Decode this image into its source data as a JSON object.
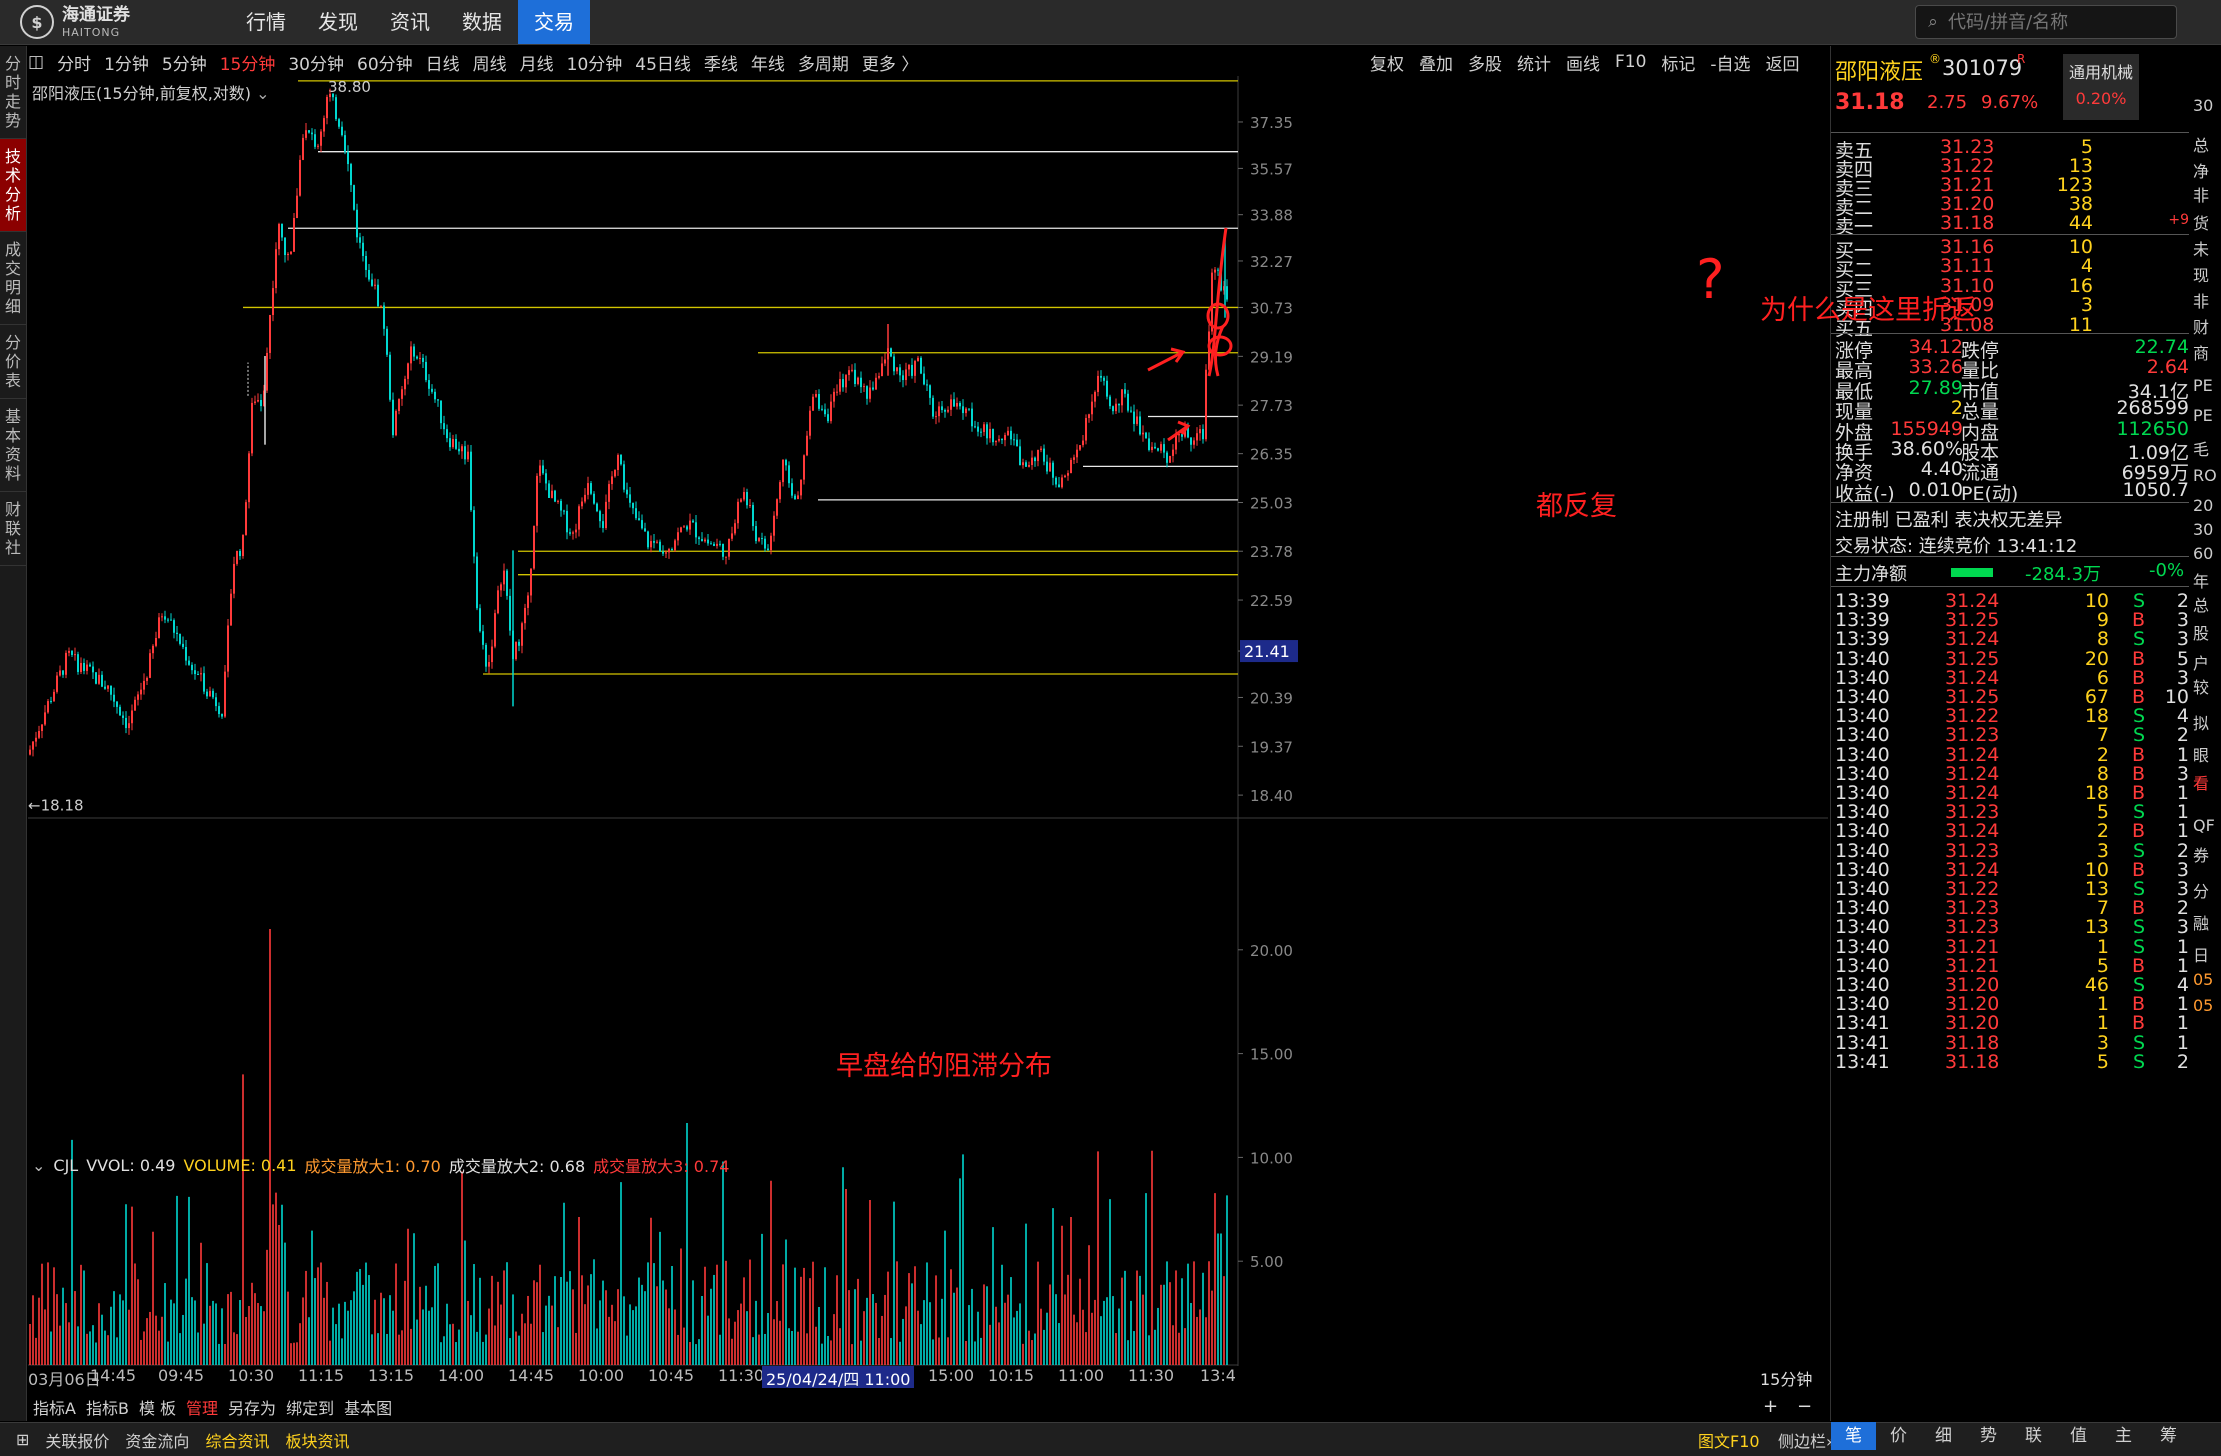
{
  "app": {
    "logo_cn": "海通证券",
    "logo_en": "HAITONG"
  },
  "mainnav": [
    "行情",
    "发现",
    "资讯",
    "数据",
    "交易"
  ],
  "search": {
    "placeholder": "代码/拼音/名称"
  },
  "sidetabs": [
    "分时走势",
    "技术分析",
    "成交明细",
    "分价表",
    "基本资料",
    "财联社"
  ],
  "periods": [
    "分时",
    "1分钟",
    "5分钟",
    "15分钟",
    "30分钟",
    "60分钟",
    "日线",
    "周线",
    "月线",
    "10分钟",
    "45日线",
    "季线",
    "年线",
    "多周期",
    "更多 〉"
  ],
  "tools": [
    "复权",
    "叠加",
    "多股",
    "统计",
    "画线",
    "F10",
    "标记",
    "-自选",
    "返回"
  ],
  "chart_title": "邵阳液压(15分钟,前复权,对数)",
  "chart_data": {
    "type": "candlestick",
    "yaxis_labels": [
      "37.35",
      "35.57",
      "33.88",
      "32.27",
      "30.73",
      "29.19",
      "27.73",
      "26.35",
      "25.03",
      "23.78",
      "22.59",
      "21.41",
      "20.39",
      "19.37",
      "18.40"
    ],
    "ylim": [
      18.0,
      39.2
    ],
    "current_price_tag": "21.41",
    "high_mark": "38.80",
    "low_mark": "←18.18",
    "levels_white": [
      36.2,
      33.4,
      27.4,
      26.0,
      25.1
    ],
    "levels_yellow": [
      39.0,
      30.73,
      29.3,
      23.78,
      23.2,
      20.9
    ],
    "volume_axis": [
      "20.00",
      "15.00",
      "10.00",
      "5.00"
    ],
    "volume_ylim": [
      0,
      25
    ]
  },
  "volume_header": {
    "name": "CJL",
    "vvol": "VVOL: 0.49",
    "volume": "VOLUME: 0.41",
    "amp1": "成交量放大1: 0.70",
    "amp2": "成交量放大2: 0.68",
    "amp3": "成交量放大3: 0.74"
  },
  "time_axis": [
    "03月06日",
    "14:45",
    "09:45",
    "10:30",
    "11:15",
    "13:15",
    "14:00",
    "14:45",
    "10:00",
    "10:45",
    "11:30",
    "13:30",
    "15:00",
    "10:15",
    "11:00",
    "11:30",
    "13:4"
  ],
  "time_highlight": "25/04/24/四 11:00",
  "period_label": "15分钟",
  "bottom_tabs": [
    "指标A",
    "指标B",
    "模 板",
    "管理",
    "另存为",
    "绑定到",
    "基本图"
  ],
  "bottom_tools": [
    "+",
    "−"
  ],
  "statusbar": [
    "关联报价",
    "资金流向",
    "综合资讯",
    "板块资讯"
  ],
  "statusbar_right": [
    "图文F10",
    "侧边栏»"
  ],
  "stock": {
    "name": "邵阳液压",
    "code": "301079",
    "r_mark": "R",
    "reg_mark": "®",
    "price": "31.18",
    "change": "2.75",
    "change_pct": "9.67%",
    "industry": "通用机械",
    "industry_pct": "0.20%"
  },
  "order_book": {
    "asks": [
      {
        "label": "卖五",
        "price": "31.23",
        "vol": "5",
        "extra": ""
      },
      {
        "label": "卖四",
        "price": "31.22",
        "vol": "13",
        "extra": ""
      },
      {
        "label": "卖三",
        "price": "31.21",
        "vol": "123",
        "extra": ""
      },
      {
        "label": "卖二",
        "price": "31.20",
        "vol": "38",
        "extra": ""
      },
      {
        "label": "卖一",
        "price": "31.18",
        "vol": "44",
        "extra": "+9"
      }
    ],
    "bids": [
      {
        "label": "买一",
        "price": "31.16",
        "vol": "10"
      },
      {
        "label": "买二",
        "price": "31.11",
        "vol": "4"
      },
      {
        "label": "买三",
        "price": "31.10",
        "vol": "16"
      },
      {
        "label": "买四",
        "price": "31.09",
        "vol": "3"
      },
      {
        "label": "买五",
        "price": "31.08",
        "vol": "11"
      }
    ]
  },
  "fundamentals": [
    {
      "l1": "涨停",
      "v1": "34.12",
      "l2": "跌停",
      "v2": "22.74"
    },
    {
      "l1": "最高",
      "v1": "33.26",
      "l2": "量比",
      "v2": "2.64"
    },
    {
      "l1": "最低",
      "v1": "27.89",
      "l2": "市值",
      "v2": "34.1亿"
    },
    {
      "l1": "现量",
      "v1": "2",
      "l2": "总量",
      "v2": "268599"
    },
    {
      "l1": "外盘",
      "v1": "155949",
      "l2": "内盘",
      "v2": "112650"
    },
    {
      "l1": "换手",
      "v1": "38.60%",
      "l2": "股本",
      "v2": "1.09亿"
    },
    {
      "l1": "净资",
      "v1": "4.40",
      "l2": "流通",
      "v2": "6959万"
    },
    {
      "l1": "收益(-)",
      "v1": "0.010",
      "l2": "PE(动)",
      "v2": "1050.7"
    }
  ],
  "reg_line": "注册制 已盈利 表决权无差异",
  "trade_status": "交易状态: 连续竞价 13:41:12",
  "main_flow": {
    "label": "主力净额",
    "value": "-284.3万",
    "pct": "-0%"
  },
  "ticks": [
    {
      "t": "13:39",
      "p": "31.24",
      "v": "10",
      "s": "S",
      "n": "2"
    },
    {
      "t": "13:39",
      "p": "31.25",
      "v": "9",
      "s": "B",
      "n": "3"
    },
    {
      "t": "13:39",
      "p": "31.24",
      "v": "8",
      "s": "S",
      "n": "3"
    },
    {
      "t": "13:40",
      "p": "31.25",
      "v": "20",
      "s": "B",
      "n": "5"
    },
    {
      "t": "13:40",
      "p": "31.24",
      "v": "6",
      "s": "B",
      "n": "3"
    },
    {
      "t": "13:40",
      "p": "31.25",
      "v": "67",
      "s": "B",
      "n": "10"
    },
    {
      "t": "13:40",
      "p": "31.22",
      "v": "18",
      "s": "S",
      "n": "4"
    },
    {
      "t": "13:40",
      "p": "31.23",
      "v": "7",
      "s": "S",
      "n": "2"
    },
    {
      "t": "13:40",
      "p": "31.24",
      "v": "2",
      "s": "B",
      "n": "1"
    },
    {
      "t": "13:40",
      "p": "31.24",
      "v": "8",
      "s": "B",
      "n": "3"
    },
    {
      "t": "13:40",
      "p": "31.24",
      "v": "18",
      "s": "B",
      "n": "1"
    },
    {
      "t": "13:40",
      "p": "31.23",
      "v": "5",
      "s": "S",
      "n": "1"
    },
    {
      "t": "13:40",
      "p": "31.24",
      "v": "2",
      "s": "B",
      "n": "1"
    },
    {
      "t": "13:40",
      "p": "31.23",
      "v": "3",
      "s": "S",
      "n": "2"
    },
    {
      "t": "13:40",
      "p": "31.24",
      "v": "10",
      "s": "B",
      "n": "3"
    },
    {
      "t": "13:40",
      "p": "31.22",
      "v": "13",
      "s": "S",
      "n": "3"
    },
    {
      "t": "13:40",
      "p": "31.23",
      "v": "7",
      "s": "B",
      "n": "2"
    },
    {
      "t": "13:40",
      "p": "31.23",
      "v": "13",
      "s": "S",
      "n": "3"
    },
    {
      "t": "13:40",
      "p": "31.21",
      "v": "1",
      "s": "S",
      "n": "1"
    },
    {
      "t": "13:40",
      "p": "31.21",
      "v": "5",
      "s": "B",
      "n": "1"
    },
    {
      "t": "13:40",
      "p": "31.20",
      "v": "46",
      "s": "S",
      "n": "4"
    },
    {
      "t": "13:40",
      "p": "31.20",
      "v": "1",
      "s": "B",
      "n": "1"
    },
    {
      "t": "13:41",
      "p": "31.20",
      "v": "1",
      "s": "B",
      "n": "1"
    },
    {
      "t": "13:41",
      "p": "31.18",
      "v": "3",
      "s": "S",
      "n": "1"
    },
    {
      "t": "13:41",
      "p": "31.18",
      "v": "5",
      "s": "S",
      "n": "2"
    }
  ],
  "right_tabs": [
    "笔",
    "价",
    "细",
    "势",
    "联",
    "值",
    "主",
    "筹"
  ],
  "far_right": [
    "30",
    "总",
    "净",
    "非",
    "货",
    "未",
    "现",
    "非",
    "财",
    "商",
    "PE",
    "PE",
    "毛",
    "RO",
    "20",
    "30",
    "60",
    "年",
    "总",
    "股",
    "户",
    "较",
    "拟",
    "眼",
    "看",
    "QF",
    "券",
    "分",
    "融",
    "日",
    "05",
    "05"
  ],
  "annotations": {
    "question": "为什么是这里折返",
    "repeat": "都反复",
    "morning": "早盘给的阻滞分布",
    "question_mark": "?"
  },
  "colors": {
    "up": "#ff3a3a",
    "down": "#00d8d0",
    "yellow_line": "#d2c400",
    "white_line": "#e8e8e8",
    "accent": "#1e6fd9",
    "annotation": "#ff2020"
  }
}
